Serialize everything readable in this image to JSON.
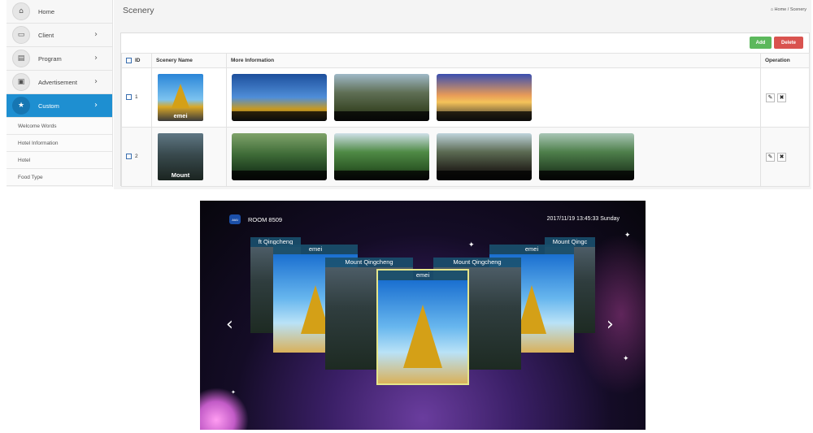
{
  "sidebar": {
    "items": [
      {
        "label": "Home",
        "icon": "home-icon",
        "glyph": "⌂",
        "chevron": ""
      },
      {
        "label": "Client",
        "icon": "monitor-icon",
        "glyph": "▭",
        "chevron": "›"
      },
      {
        "label": "Program",
        "icon": "film-icon",
        "glyph": "▤",
        "chevron": "›"
      },
      {
        "label": "Advertisement",
        "icon": "picture-icon",
        "glyph": "▣",
        "chevron": "›"
      },
      {
        "label": "Custom",
        "icon": "star-icon",
        "glyph": "★",
        "chevron": "›",
        "active": true
      }
    ],
    "subitems": [
      "Welcome Words",
      "Hotel Information",
      "Hotel",
      "Food Type"
    ]
  },
  "header": {
    "title": "Scenery",
    "breadcrumb_home": "Home",
    "breadcrumb_sep": "/",
    "breadcrumb_current": "Scenery",
    "home_glyph": "⌂"
  },
  "toolbar": {
    "add_label": "Add",
    "delete_label": "Delete"
  },
  "table": {
    "columns": {
      "id": "ID",
      "name": "Scenery Name",
      "info": "More Information",
      "op": "Operation"
    },
    "rows": [
      {
        "id": "1",
        "name": "emei",
        "images": 3
      },
      {
        "id": "2",
        "name": "Mount",
        "images": 4
      }
    ],
    "edit_glyph": "✎",
    "delete_glyph": "✖"
  },
  "tv": {
    "logo": "AIAI",
    "room": "ROOM 8509",
    "datetime": "2017/11/19  13:45:33  Sunday",
    "prev_glyph": "‹",
    "next_glyph": "›",
    "cards": {
      "far_left": "ft Qingcheng",
      "far_right": "Mount Qingc",
      "mid_left": "emei",
      "mid_right": "emei",
      "near_left": "Mount Qingcheng",
      "near_right": "Mount Qingcheng",
      "center": "emei"
    }
  },
  "colors": {
    "accent": "#1e8fd1",
    "add": "#5cb85c",
    "delete": "#d9534f",
    "tv_bg": "#07060c"
  }
}
